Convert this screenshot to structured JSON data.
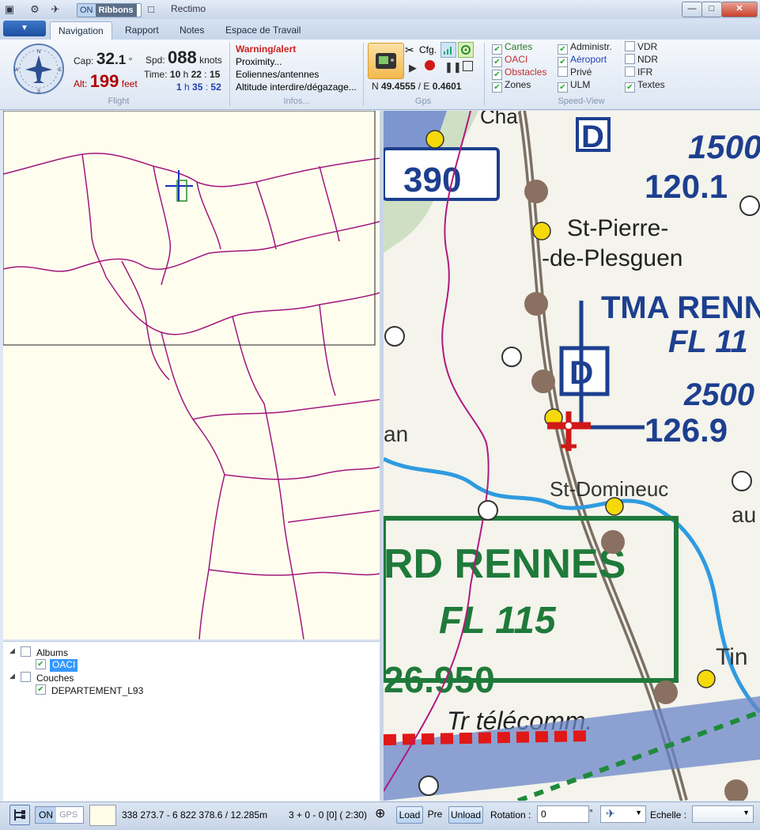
{
  "window": {
    "title": "Rectimo",
    "ribbons_on": "ON",
    "ribbons_label": "Ribbons",
    "min": "—",
    "max": "□",
    "close": "✕"
  },
  "tabs": [
    "Navigation",
    "Rapport",
    "Notes",
    "Espace de Travail"
  ],
  "flight": {
    "cap_label": "Cap:",
    "cap_int": "32",
    "cap_dec": ".1",
    "cap_unit": "°",
    "spd_label": "Spd:",
    "spd_value": "088",
    "spd_unit": "knots",
    "alt_label": "Alt:",
    "alt_value": "199",
    "alt_unit": "feet",
    "time_label": "Time:",
    "time_h": "10",
    "time_m": "22",
    "time_s": "15",
    "elapsed_h": "1",
    "elapsed_m": "35",
    "elapsed_s": "52",
    "group": "Flight"
  },
  "infos": {
    "items": [
      "Warning/alert",
      "Proximity...",
      "Eoliennes/antennes",
      "Altitude interdire/dégazage..."
    ],
    "group": "Infos..."
  },
  "gps": {
    "cfg": "Cfg.",
    "n_label": "N",
    "n_value": "49.4555",
    "e_label": "E",
    "e_value": "0.4601",
    "group": "Gps"
  },
  "speedview": {
    "col1": [
      {
        "label": "Cartes",
        "checked": true,
        "color": "#2a7a2a"
      },
      {
        "label": "OACI",
        "checked": true,
        "color": "#c03030"
      },
      {
        "label": "Obstacles",
        "checked": true,
        "color": "#c03030"
      },
      {
        "label": "Zones",
        "checked": true,
        "color": "#222"
      }
    ],
    "col2": [
      {
        "label": "Administr.",
        "checked": true,
        "color": "#222"
      },
      {
        "label": "Aéroport",
        "checked": true,
        "color": "#2040b0"
      },
      {
        "label": "Privé",
        "checked": false,
        "color": "#222"
      },
      {
        "label": "ULM",
        "checked": true,
        "color": "#222"
      }
    ],
    "col3": [
      {
        "label": "VDR",
        "checked": false,
        "color": "#222"
      },
      {
        "label": "NDR",
        "checked": false,
        "color": "#222"
      },
      {
        "label": "IFR",
        "checked": false,
        "color": "#222"
      },
      {
        "label": "Textes",
        "checked": true,
        "color": "#222"
      }
    ],
    "group": "Speed-View"
  },
  "map": {
    "labels": [
      "Chat.",
      "390",
      "St-Pierre-",
      "-de-Plesguen",
      "TMA RENN",
      "FL 11",
      "D",
      "D",
      "1500",
      "120.1",
      "2500",
      "126.9",
      "an",
      "St-Domineuc",
      "RD RENNES",
      "FL 115",
      "26.950",
      "Tr télécomm.",
      "Tin",
      "au"
    ]
  },
  "tree": {
    "albums": "Albums",
    "oaci": "OACI",
    "couches": "Couches",
    "dept": "DEPARTEMENT_L93"
  },
  "status": {
    "on": "ON",
    "gps": "GPS",
    "coords": "338 273.7 - 6 822 378.6 / 12.285m",
    "counter": "3 + 0 - 0 [0]  ( 2:30)",
    "load": "Load",
    "pre": "Pre",
    "unload": "Unload",
    "rotation_label": "Rotation :",
    "rotation_value": "0",
    "rotation_unit": "°",
    "echelle_label": "Echelle :"
  }
}
